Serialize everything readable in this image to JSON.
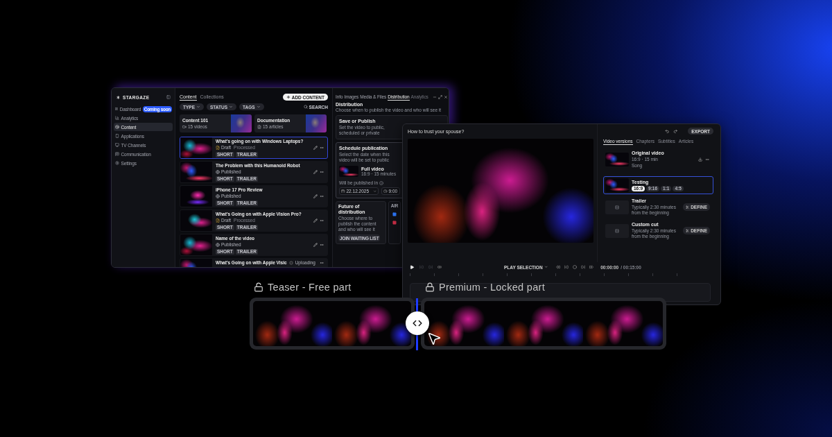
{
  "cms": {
    "sidebar": {
      "brand": "STARGAZE",
      "items": [
        {
          "label": "Dashboard",
          "badge": "Coming soon",
          "selected": false
        },
        {
          "label": "Analytics",
          "selected": false
        },
        {
          "label": "Content",
          "selected": true
        },
        {
          "label": "Applications",
          "selected": false
        },
        {
          "label": "TV Channels",
          "selected": false
        },
        {
          "label": "Communication",
          "selected": false
        },
        {
          "label": "Settings",
          "selected": false
        }
      ]
    },
    "content": {
      "tabs": [
        {
          "label": "Content",
          "selected": true
        },
        {
          "label": "Collections",
          "selected": false
        }
      ],
      "add_button": "ADD CONTENT",
      "filters": [
        "TYPE",
        "STATUS",
        "TAGS"
      ],
      "search": "SEARCH",
      "collections": [
        {
          "title": "Content 101",
          "meta": "15 videos"
        },
        {
          "title": "Documentation",
          "meta": "15 articles"
        }
      ],
      "videos": [
        {
          "kind": "draft",
          "title": "What's going on with Windows Laptops?",
          "status": "Draft",
          "note": "Processed",
          "tags": [
            "SHORT",
            "TRAILER"
          ],
          "selected": true
        },
        {
          "kind": "published",
          "title": "The Problem with this Humanoid Robot",
          "status": "Published",
          "tags": [
            "SHORT",
            "TRAILER"
          ],
          "selected": false
        },
        {
          "kind": "published",
          "title": "iPhone 17 Pro Review",
          "status": "Published",
          "tags": [
            "SHORT",
            "TRAILER"
          ],
          "selected": false
        },
        {
          "kind": "draft",
          "title": "What's Going on with Apple Vision Pro?",
          "status": "Draft",
          "note": "Processed",
          "tags": [
            "SHORT",
            "TRAILER"
          ],
          "selected": false
        },
        {
          "kind": "published",
          "title": "Name of the video",
          "status": "Published",
          "tags": [
            "SHORT",
            "TRAILER"
          ],
          "selected": false
        },
        {
          "kind": "uploading",
          "title": "What's Going on with Apple Visic",
          "status": "Uploading",
          "selected": false
        }
      ]
    },
    "distribution": {
      "tabs": [
        {
          "label": "Info",
          "selected": false,
          "disabled": false
        },
        {
          "label": "Images",
          "selected": false,
          "disabled": false
        },
        {
          "label": "Media & Files",
          "selected": false,
          "disabled": false
        },
        {
          "label": "Distribution",
          "selected": true,
          "disabled": false
        },
        {
          "label": "Analytics",
          "selected": false,
          "disabled": true
        }
      ],
      "title": "Distribution",
      "subtitle": "Choose when to publish the video and who will see it",
      "save": {
        "title": "Save or Publish",
        "text": "Set the video to public, scheduled or private"
      },
      "schedule": {
        "title": "Schedule publication",
        "text": "Select the date when this video will be set to public",
        "video_title": "Full video",
        "video_meta": "16:9 · 15 minutes",
        "publish_label": "Will be published in",
        "date": "22.12.2025",
        "time": "9:00"
      },
      "future": {
        "title": "Future of distribution",
        "text": "Choose where to publish the content and who will see it",
        "button": "JOIN WAITING LIST",
        "side_label": "AIR"
      }
    }
  },
  "editor": {
    "title": "How to trust your spouse?",
    "export": "EXPORT",
    "tabs": [
      {
        "label": "Video versions",
        "selected": true
      },
      {
        "label": "Chapters",
        "selected": false
      },
      {
        "label": "Subtitles",
        "selected": false
      },
      {
        "label": "Articles",
        "selected": false
      }
    ],
    "versions": [
      {
        "kind": "video",
        "title": "Original video",
        "meta": "16:9 · 15 min",
        "note": "Song",
        "selected": false
      },
      {
        "kind": "video",
        "title": "Testing",
        "ratios": [
          {
            "label": "16:9",
            "selected": true
          },
          {
            "label": "9:16",
            "selected": false
          },
          {
            "label": "1:1",
            "selected": false
          },
          {
            "label": "4:5",
            "selected": false
          }
        ],
        "selected": true
      },
      {
        "kind": "empty",
        "title": "Trailer",
        "text": "Typically 2:30 minutes from the beginning",
        "button": "DEFINE",
        "selected": false
      },
      {
        "kind": "empty",
        "title": "Custom cut",
        "text": "Typically 2:30 minutes from the beginning",
        "button": "DEFINE",
        "selected": false
      }
    ],
    "player": {
      "play_selection": "PLAY SELECTION",
      "time": "00:00:00",
      "duration": "/ 00:15:00"
    }
  },
  "preview": {
    "segments": [
      {
        "label": "Teaser - Free part",
        "locked": false,
        "frames": [
          {
            "kind": "photo"
          },
          {
            "kind": "photo"
          }
        ]
      },
      {
        "label": "Premium - Locked part",
        "locked": true,
        "frames": [
          {
            "kind": "photo"
          },
          {
            "kind": "photo"
          },
          {
            "kind": "photo"
          }
        ]
      }
    ]
  }
}
